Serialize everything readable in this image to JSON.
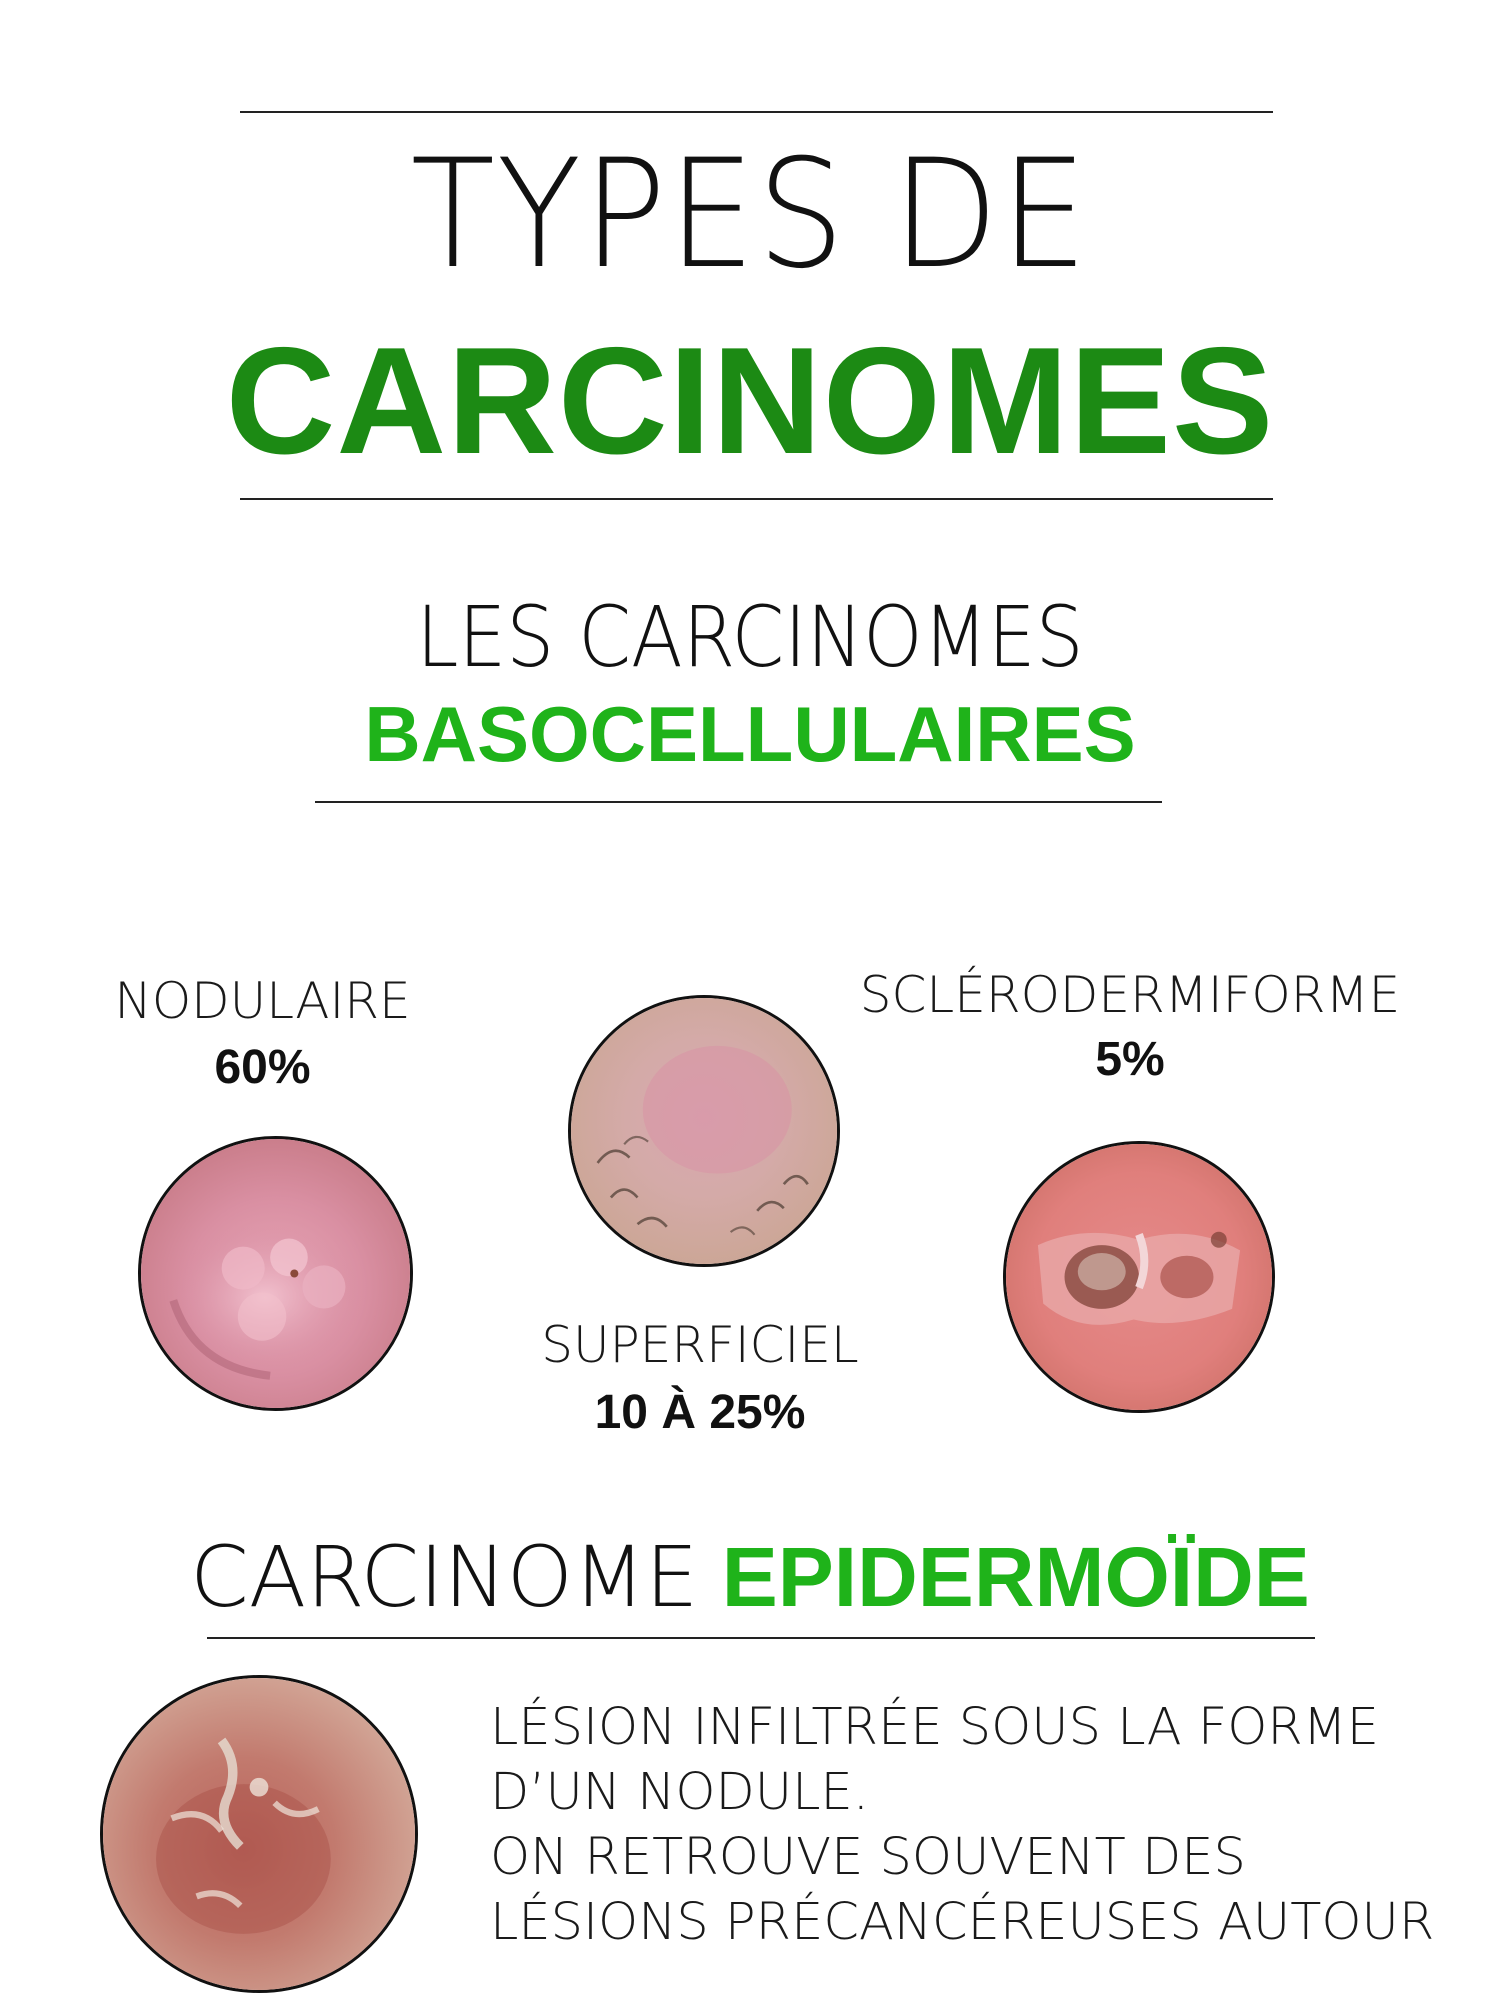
{
  "header": {
    "title_line1": "TYPES DE",
    "title_line2": "CARCINOMES"
  },
  "basocellular": {
    "heading_line1": "LES CARCINOMES",
    "heading_line2": "BASOCELLULAIRES",
    "types": [
      {
        "label": "NODULAIRE",
        "percent": "60%",
        "image": "nodular-lesion-photo"
      },
      {
        "label": "SUPERFICIEL",
        "percent": "10 À 25%",
        "image": "superficial-lesion-photo"
      },
      {
        "label": "SCLÉRODERMIFORME",
        "percent": "5%",
        "image": "sclerodermiform-lesion-photo"
      }
    ]
  },
  "epidermoid": {
    "heading_light": "CARCINOME",
    "heading_bold": "EPIDERMOÏDE",
    "image": "epidermoid-lesion-photo",
    "description_lines": [
      "LÉSION INFILTRÉE SOUS LA FORME",
      "D’UN NODULE.",
      "ON RETROUVE SOUVENT DES",
      "LÉSIONS PRÉCANCÉREUSES AUTOUR"
    ]
  },
  "colors": {
    "title_green": "#1c8a14",
    "accent_green": "#1fb31a",
    "text": "#111111"
  }
}
